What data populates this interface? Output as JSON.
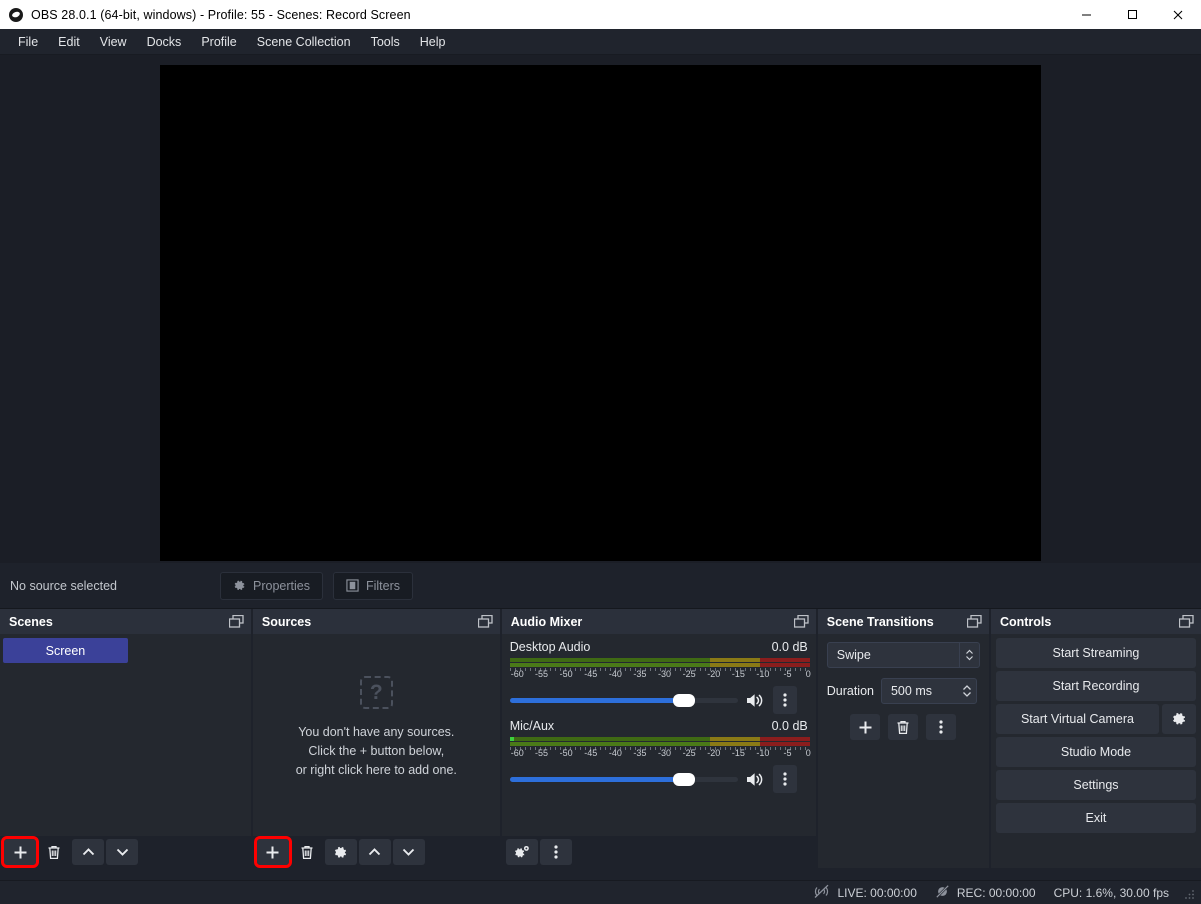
{
  "titlebar": {
    "title": "OBS 28.0.1 (64-bit, windows) - Profile: 55 - Scenes: Record Screen",
    "app_icon": "obs-icon",
    "minimize": "minimize-icon",
    "maximize": "maximize-icon",
    "close": "close-icon"
  },
  "menubar": {
    "items": [
      {
        "label": "File"
      },
      {
        "label": "Edit"
      },
      {
        "label": "View"
      },
      {
        "label": "Docks"
      },
      {
        "label": "Profile"
      },
      {
        "label": "Scene Collection"
      },
      {
        "label": "Tools"
      },
      {
        "label": "Help"
      }
    ]
  },
  "preview": {
    "canvas_color": "#000000",
    "background_color": "#1b1e26"
  },
  "source_toolbar": {
    "status_label": "No source selected",
    "properties_label": "Properties",
    "filters_label": "Filters",
    "disabled": true
  },
  "scenes": {
    "title": "Scenes",
    "items": [
      {
        "label": "Screen",
        "selected": true
      }
    ],
    "selected_color": "#3b4199",
    "footer": {
      "add_label": "+",
      "add_highlighted": true,
      "remove_label": "Remove",
      "up_label": "Move up",
      "down_label": "Move down"
    }
  },
  "sources": {
    "title": "Sources",
    "empty_icon": "question-mark-icon",
    "empty_lines": [
      "You don't have any sources.",
      "Click the + button below,",
      "or right click here to add one."
    ],
    "footer": {
      "add_label": "+",
      "add_highlighted": true,
      "remove_label": "Remove",
      "properties_label": "Properties",
      "up_label": "Move up",
      "down_label": "Move down"
    }
  },
  "audio_mixer": {
    "title": "Audio Mixer",
    "tick_labels": [
      "-60",
      "-55",
      "-50",
      "-45",
      "-40",
      "-35",
      "-30",
      "-25",
      "-20",
      "-15",
      "-10",
      "-5",
      "0"
    ],
    "tracks": [
      {
        "name": "Desktop Audio",
        "db": "0.0 dB",
        "volume_percent": 74,
        "level_percent": 0,
        "muted": false
      },
      {
        "name": "Mic/Aux",
        "db": "0.0 dB",
        "volume_percent": 74,
        "level_percent": 1.5,
        "muted": false
      }
    ],
    "footer": {
      "advanced_label": "Advanced Audio Properties",
      "menu_label": "Menu"
    }
  },
  "scene_transitions": {
    "title": "Scene Transitions",
    "transition": "Swipe",
    "duration_label": "Duration",
    "duration_value": "500 ms",
    "buttons": {
      "add_label": "+",
      "remove_label": "Remove",
      "menu_label": "Menu"
    }
  },
  "controls": {
    "title": "Controls",
    "buttons": [
      {
        "label": "Start Streaming"
      },
      {
        "label": "Start Recording"
      },
      {
        "label": "Start Virtual Camera"
      },
      {
        "label": "Studio Mode"
      },
      {
        "label": "Settings"
      },
      {
        "label": "Exit"
      }
    ],
    "vcam_settings_icon": "gear-icon"
  },
  "statusbar": {
    "live_label": "LIVE: 00:00:00",
    "rec_label": "REC: 00:00:00",
    "cpu_label": "CPU: 1.6%, 30.00 fps",
    "live_icon": "stream-inactive-icon",
    "rec_icon": "record-inactive-icon",
    "grip_icon": "resize-grip-icon"
  }
}
